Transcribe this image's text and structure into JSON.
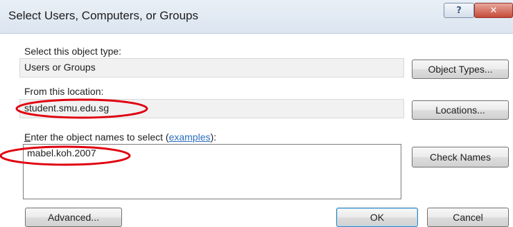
{
  "window": {
    "title": "Select Users, Computers, or Groups",
    "help_glyph": "?",
    "close_glyph": "✕"
  },
  "object_type": {
    "label": "Select this object type:",
    "value": "Users or Groups",
    "button": "Object Types..."
  },
  "location": {
    "label": "From this location:",
    "value": "student.smu.edu.sg",
    "button": "Locations..."
  },
  "names": {
    "label_accel": "E",
    "label_rest": "nter the object names to select (",
    "label_link": "examples",
    "label_end": "):",
    "value": "mabel.koh.2007",
    "check_button": "Check Names"
  },
  "footer": {
    "advanced_button": "Advanced...",
    "ok_button": "OK",
    "cancel_button": "Cancel"
  },
  "annotation_color": "#e0000f"
}
